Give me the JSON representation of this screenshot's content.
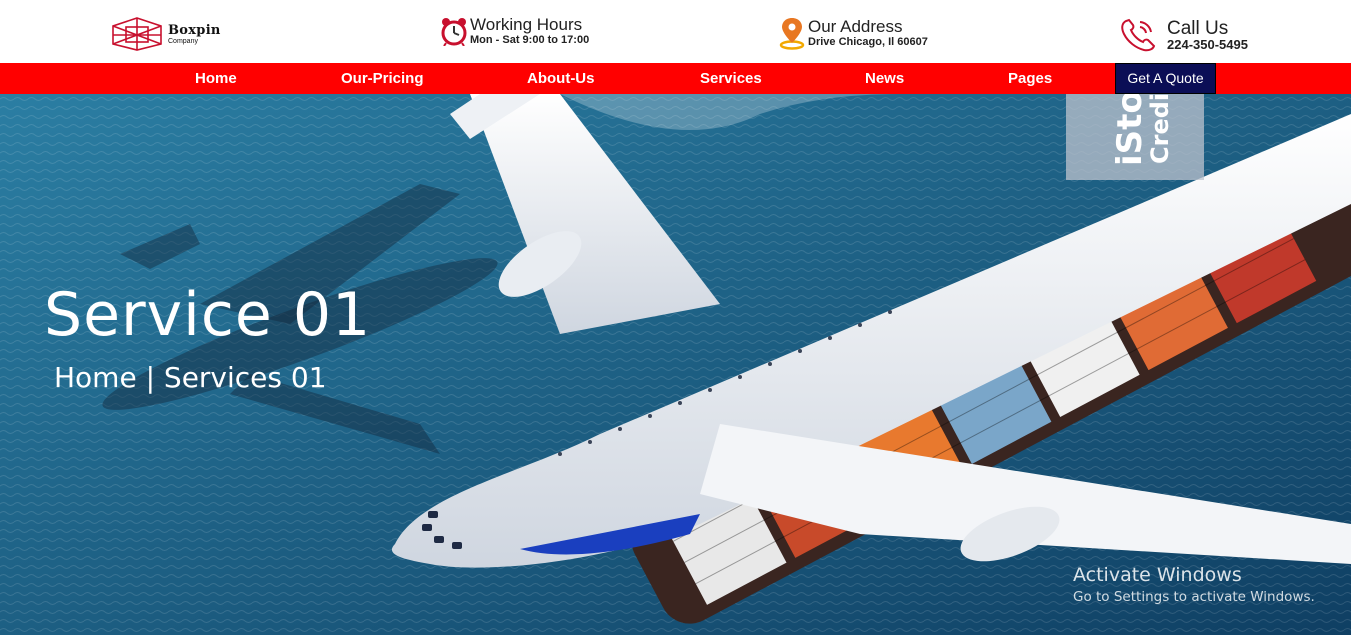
{
  "brand": {
    "name": "Boxpin",
    "tagline": "Company"
  },
  "info": {
    "hours": {
      "title": "Working Hours",
      "detail": "Mon - Sat 9:00 to 17:00",
      "icon": "alarm-clock-icon"
    },
    "address": {
      "title": "Our Address",
      "detail": "Drive Chicago, Il 60607",
      "icon": "location-pin-icon"
    },
    "call": {
      "title": "Call Us",
      "detail": "224-350-5495",
      "icon": "phone-icon"
    }
  },
  "nav": {
    "items": [
      "Home",
      "Our-Pricing",
      "About-Us",
      "Services",
      "News",
      "Pages"
    ],
    "cta": "Get A Quote"
  },
  "hero": {
    "title": "Service 01",
    "breadcrumb": "Home | Services 01",
    "stock_mark": {
      "line1": "iSto",
      "line2": "Credit"
    }
  },
  "os_watermark": {
    "title": "Activate Windows",
    "subtitle": "Go to Settings to activate Windows."
  },
  "colors": {
    "nav_bg": "#ff0000",
    "cta_bg": "#0b0e56",
    "brand_red": "#c8102e",
    "icon_orange": "#e87722",
    "sea": "#1d5f83"
  }
}
